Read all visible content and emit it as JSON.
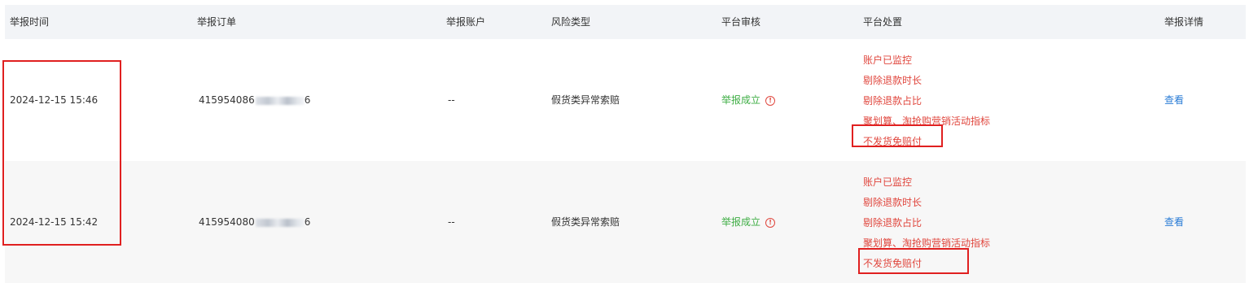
{
  "columns": {
    "report_time": "举报时间",
    "report_order": "举报订单",
    "report_account": "举报账户",
    "risk_type": "风险类型",
    "platform_review": "平台审核",
    "platform_action": "平台处置",
    "report_detail": "举报详情"
  },
  "rows": [
    {
      "time": "2024-12-15 15:46",
      "order_visible": "415954086",
      "order_tail": "6",
      "account": "--",
      "risk_type": "假货类异常索赔",
      "review_status": "举报成立",
      "actions": [
        "账户已监控",
        "剔除退款时长",
        "剔除退款占比",
        "聚划算、淘抢购营销活动指标",
        "不发货免赔付"
      ],
      "detail_link": "查看"
    },
    {
      "time": "2024-12-15 15:42",
      "order_visible": "415954080",
      "order_tail": "6",
      "account": "--",
      "risk_type": "假货类异常索赔",
      "review_status": "举报成立",
      "actions": [
        "账户已监控",
        "剔除退款时长",
        "剔除退款占比",
        "聚划算、淘抢购营销活动指标",
        "不发货免赔付"
      ],
      "detail_link": "查看"
    }
  ],
  "colors": {
    "status_green": "#3fae45",
    "action_red": "#e0463d",
    "link_blue": "#2a7cd6",
    "annotation_red": "#e02020"
  },
  "icons": {
    "info": "info-circle-icon"
  }
}
